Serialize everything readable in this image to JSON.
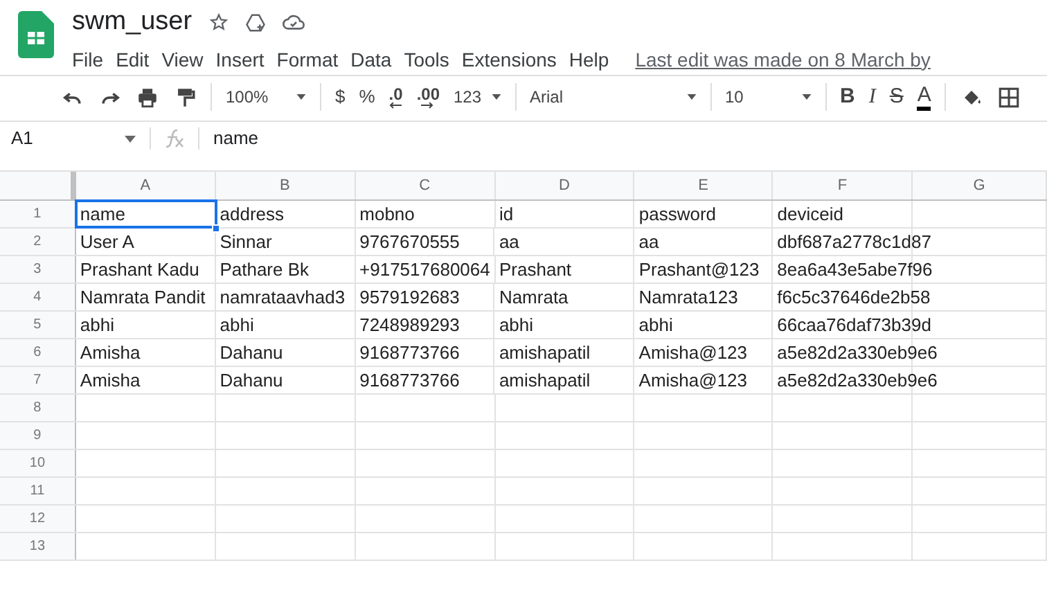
{
  "document": {
    "title": "swm_user"
  },
  "menu": [
    "File",
    "Edit",
    "View",
    "Insert",
    "Format",
    "Data",
    "Tools",
    "Extensions",
    "Help"
  ],
  "last_edit": "Last edit was made on 8 March by",
  "toolbar": [
    {
      "kind": "icon"
    },
    {
      "kind": "icon"
    },
    {
      "kind": "icon"
    },
    {
      "kind": "icon"
    },
    {
      "kind": "sep"
    },
    {
      "kind": "dropdown",
      "label": "100%"
    },
    {
      "kind": "sep"
    },
    {
      "kind": "text",
      "label": "$"
    },
    {
      "kind": "text",
      "label": "%"
    },
    {
      "kind": "decimal",
      "label": ".0"
    },
    {
      "kind": "decimal",
      "label": ".00"
    },
    {
      "kind": "dropdown",
      "label": "123"
    },
    {
      "kind": "sep"
    },
    {
      "kind": "dropdown",
      "label": "Arial"
    },
    {
      "kind": "sep"
    },
    {
      "kind": "dropdown",
      "label": "10"
    },
    {
      "kind": "sep"
    },
    {
      "kind": "bold",
      "label": "B"
    },
    {
      "kind": "italic",
      "label": "I"
    },
    {
      "kind": "strike",
      "label": "S"
    },
    {
      "kind": "color",
      "label": "A"
    },
    {
      "kind": "sep"
    },
    {
      "kind": "icon"
    },
    {
      "kind": "icon"
    }
  ],
  "formula_bar": {
    "cell": "A1",
    "value": "name"
  },
  "columns": [
    "A",
    "B",
    "C",
    "D",
    "E",
    "F",
    "G"
  ],
  "rows": [
    {
      "label": "1",
      "cells": [
        {
          "text": "name",
          "selected": true
        },
        {
          "text": "address"
        },
        {
          "text": "mobno"
        },
        {
          "text": "id"
        },
        {
          "text": "password"
        },
        {
          "text": "deviceid"
        }
      ]
    },
    {
      "label": "2",
      "cells": [
        {
          "text": "User A"
        },
        {
          "text": "Sinnar"
        },
        {
          "text": "9767670555"
        },
        {
          "text": "aa"
        },
        {
          "text": "aa"
        },
        {
          "text": "dbf687a2778c1d87"
        }
      ]
    },
    {
      "label": "3",
      "cells": [
        {
          "text": "Prashant Kadu"
        },
        {
          "text": "Pathare Bk"
        },
        {
          "text": "+917517680064"
        },
        {
          "text": "Prashant"
        },
        {
          "text": "Prashant@123"
        },
        {
          "text": "8ea6a43e5abe7f96"
        }
      ]
    },
    {
      "label": "4",
      "cells": [
        {
          "text": "Namrata Pandit"
        },
        {
          "text": "namrataavhad3"
        },
        {
          "text": "9579192683"
        },
        {
          "text": "Namrata"
        },
        {
          "text": "Namrata123"
        },
        {
          "text": "f6c5c37646de2b58"
        }
      ]
    },
    {
      "label": "5",
      "cells": [
        {
          "text": "abhi"
        },
        {
          "text": "abhi"
        },
        {
          "text": "7248989293"
        },
        {
          "text": "abhi"
        },
        {
          "text": "abhi"
        },
        {
          "text": "66caa76daf73b39d"
        }
      ]
    },
    {
      "label": "6",
      "cells": [
        {
          "text": "Amisha"
        },
        {
          "text": "Dahanu"
        },
        {
          "text": "9168773766"
        },
        {
          "text": "amishapatil"
        },
        {
          "text": "Amisha@123"
        },
        {
          "text": "a5e82d2a330eb9e6"
        }
      ]
    },
    {
      "label": "7",
      "cells": [
        {
          "text": "Amisha"
        },
        {
          "text": "Dahanu"
        },
        {
          "text": "9168773766"
        },
        {
          "text": "amishapatil"
        },
        {
          "text": "Amisha@123"
        },
        {
          "text": "a5e82d2a330eb9e6"
        }
      ]
    },
    {
      "label": "8",
      "cells": []
    },
    {
      "label": "9",
      "cells": []
    },
    {
      "label": "10",
      "cells": []
    },
    {
      "label": "11",
      "cells": []
    },
    {
      "label": "12",
      "cells": []
    },
    {
      "label": "13",
      "cells": []
    }
  ]
}
